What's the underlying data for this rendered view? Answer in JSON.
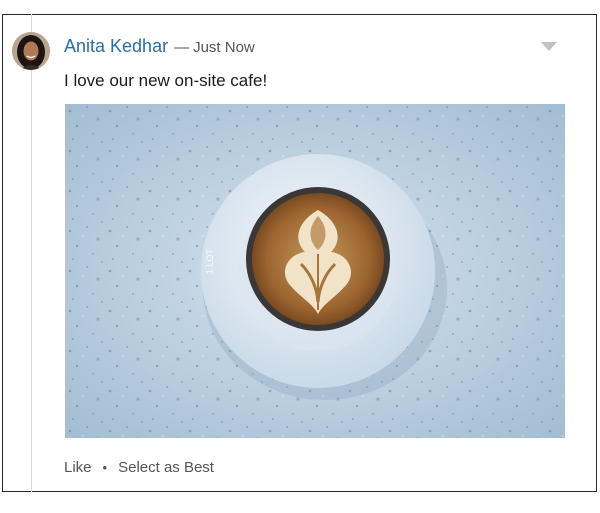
{
  "post": {
    "author": "Anita Kedhar",
    "separator": "—",
    "timestamp": "Just Now",
    "text": "I love our new on-site cafe!",
    "image_icon": "latte-art-photo"
  },
  "actions": {
    "like_label": "Like",
    "separator": "•",
    "select_best_label": "Select as Best"
  },
  "icons": {
    "menu": "chevron-down-icon",
    "avatar": "avatar"
  },
  "colors": {
    "author_link": "#2a6ea8",
    "meta_text": "#555555",
    "caret": "#c2c2c2"
  }
}
